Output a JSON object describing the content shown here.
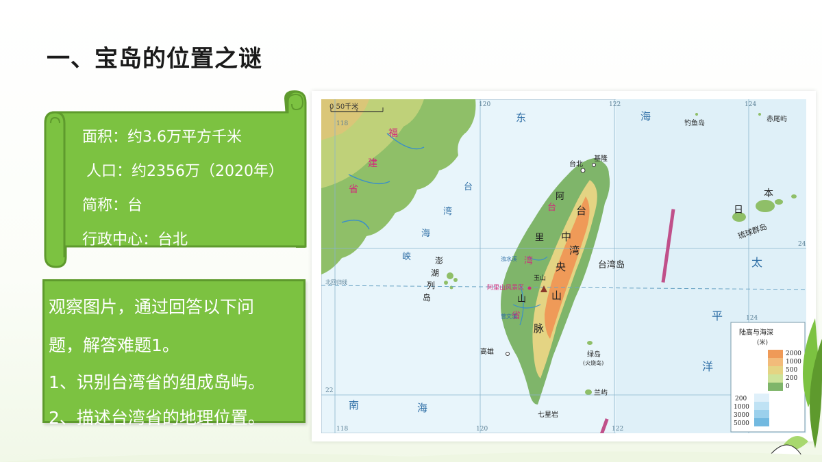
{
  "title": "一、宝岛的位置之谜",
  "info": {
    "area": "面积：约3.6万平方千米",
    "population": "人口：约2356万（2020年）",
    "abbr": "简称：台",
    "capital": "行政中心：台北"
  },
  "questions": {
    "line1": "观察图片，通过回答以下问",
    "line2": "题，解答难题1。",
    "line3": "1、识别台湾省的组成岛屿。",
    "line4": "2、描述台湾省的地理位置。"
  },
  "map": {
    "scale": "0      50千米",
    "lon_118": "118",
    "lon_120": "120",
    "lon_122": "122",
    "lon_124": "124",
    "lat_24": "24",
    "lat_22": "22",
    "tropic": "北回归线",
    "sea_east": [
      "东",
      "海"
    ],
    "strait": [
      "台",
      "湾",
      "海",
      "峡"
    ],
    "fujian": [
      "福",
      "建",
      "省"
    ],
    "taiwan_prov": [
      "台",
      "湾",
      "省"
    ],
    "penghu": [
      "澎",
      "湖",
      "列",
      "岛"
    ],
    "taipei": "台北",
    "keelung": "基隆",
    "kaohsiung": "高雄",
    "alishan_range": [
      "阿",
      "里",
      "山"
    ],
    "central_range": [
      "台",
      "湾",
      "中",
      "央",
      "山",
      "脉"
    ],
    "yushan": "玉山",
    "alishan_scenic": "阿里山风景区",
    "taiwan_island": "台湾岛",
    "diaoyu": "钓鱼岛",
    "chiwei": "赤尾屿",
    "japan": [
      "日",
      "本"
    ],
    "ryukyu": "琉球群岛",
    "pacific": [
      "太",
      "平",
      "洋"
    ],
    "south_sea": [
      "南",
      "海"
    ],
    "green_island": "绿岛",
    "green_island_alt": "(火烧岛)",
    "lanyu": "兰屿",
    "qixing": "七星岩",
    "river1": "浊水溪",
    "river2": "曾文溪",
    "legend_title": "陆高与海深",
    "legend_unit": "(米)",
    "legend_land": [
      "2000",
      "1000",
      "500",
      "200",
      "0"
    ],
    "legend_sea": [
      "200",
      "1000",
      "3000",
      "5000"
    ],
    "colors": {
      "sea": "#e8f5fb",
      "land_low": "#7fb56a",
      "land_mid": "#e4d483",
      "land_high": "#ef9a58",
      "label_red": "#d02c7a",
      "label_blue": "#2f6fa6"
    }
  }
}
